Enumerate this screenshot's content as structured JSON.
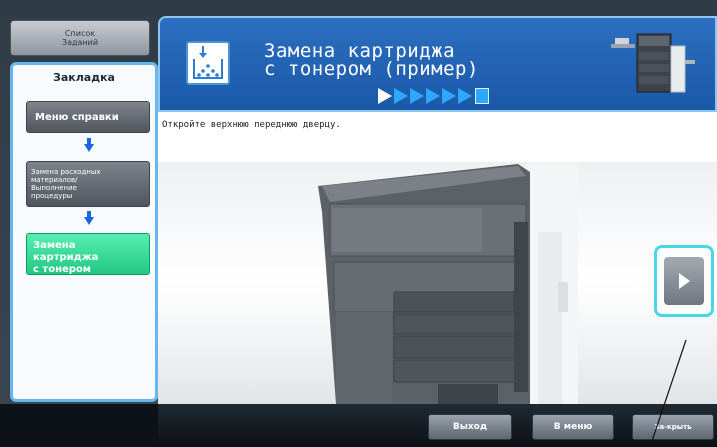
{
  "nav": {
    "job_list_label_1": "Список",
    "job_list_label_2": "Заданий",
    "sidebar_title": "Закладка",
    "items": [
      {
        "label": "Меню справки"
      },
      {
        "label_lines": [
          "Замена расходных",
          "материалов/",
          "Выполнение",
          "процедуры"
        ]
      },
      {
        "label_lines": [
          "Замена картриджа",
          "с тонером"
        ]
      }
    ]
  },
  "header": {
    "title_line1": "Замена картриджа",
    "title_line2": "с тонером (пример)",
    "steps_total": 7,
    "current_step": 1
  },
  "content": {
    "instruction": "Откройте верхнюю переднюю дверцу."
  },
  "footer": {
    "exit_label": "Выход",
    "menu_label": "В меню",
    "close_label_1": "За-",
    "close_label_2": "крыть"
  },
  "colors": {
    "header_blue": "#1f5fb0",
    "active_green": "#2bd58f",
    "sidebar_border": "#66b7ec",
    "highlight_cyan": "#48d7e6"
  }
}
